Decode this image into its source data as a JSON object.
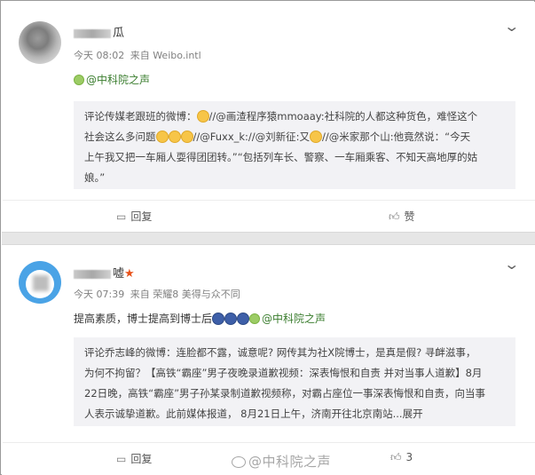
{
  "post1": {
    "username_tail": "瓜",
    "time": "今天 08:02",
    "source": "来自 Weibo.intl",
    "topic_link": "@中科院之声",
    "quote_lines": [
      "评论传媒老跟班的微博：",
      "//@画渣程序猿mmoaay:社科院的人都这种货色，难怪这个",
      "社会这么多问题",
      "//@Fuxx_k://@刘新征:又",
      "//@米家那个山:他竟然说：“今天",
      "上午我又把一车厢人耍得团团转。”“包括列车长、警察、一车厢乘客、不知天高地厚的姑",
      "娘。”"
    ],
    "reply_label": "回复",
    "like_label": "赞"
  },
  "post2": {
    "username_tail": "嘘",
    "time": "今天 07:39",
    "source": "来自 荣耀8 美得与众不同",
    "text_prefix": "提高素质，博士提高到博士后",
    "topic_link": "@中科院之声",
    "quote_lines": [
      "评论乔志峰的微博：连脸都不露，诚意呢? 网传其为社X院博士，是真是假? 寻衅滋事，",
      "为何不拘留？【高铁“霸座”男子夜晚录道歉视频：深表悔恨和自责 并对当事人道歉】8月",
      "22日晚，高铁“霸座”男子孙某录制道歉视频称，对霸占座位一事深表悔恨和自责，向当事",
      "人表示诚挚道歉。此前媒体报道， 8月21日上午，济南开往北京南站...展开"
    ],
    "reply_label": "回复",
    "like_count": "3"
  },
  "watermark": "@中科院之声",
  "icons": {
    "chevron": "chevron-down-icon",
    "reply": "comment-icon",
    "like": "thumb-up-icon",
    "vip": "star-icon"
  },
  "colors": {
    "link": "#3a7d2e",
    "vip": "#e8521a",
    "quote_bg": "#f2f2f5"
  }
}
